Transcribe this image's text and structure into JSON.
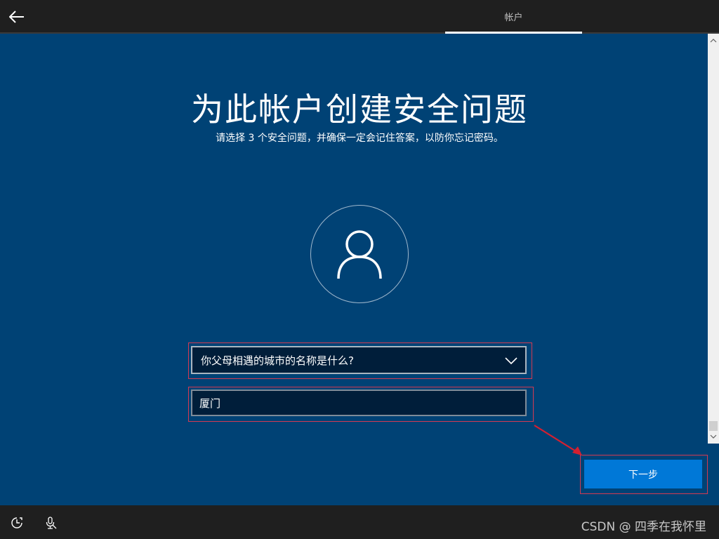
{
  "header": {
    "tab_label": "帐户"
  },
  "main": {
    "title": "为此帐户创建安全问题",
    "subtitle": "请选择 3 个安全问题，并确保一定会记住答案，以防你忘记密码。",
    "question_select": {
      "value": "你父母相遇的城市的名称是什么?"
    },
    "answer_input": {
      "value": "厦门"
    },
    "next_button_label": "下一步"
  },
  "footer": {
    "watermark": "CSDN @ 四季在我怀里"
  },
  "colors": {
    "background": "#004275",
    "topbar": "#1f1f1f",
    "button_accent": "#0078d7",
    "annotation_red": "#d42030"
  },
  "icons": {
    "back": "arrow-left-icon",
    "avatar": "user-icon",
    "chevron": "chevron-down-icon",
    "ease_of_access": "ease-of-access-icon",
    "microphone": "microphone-icon"
  }
}
